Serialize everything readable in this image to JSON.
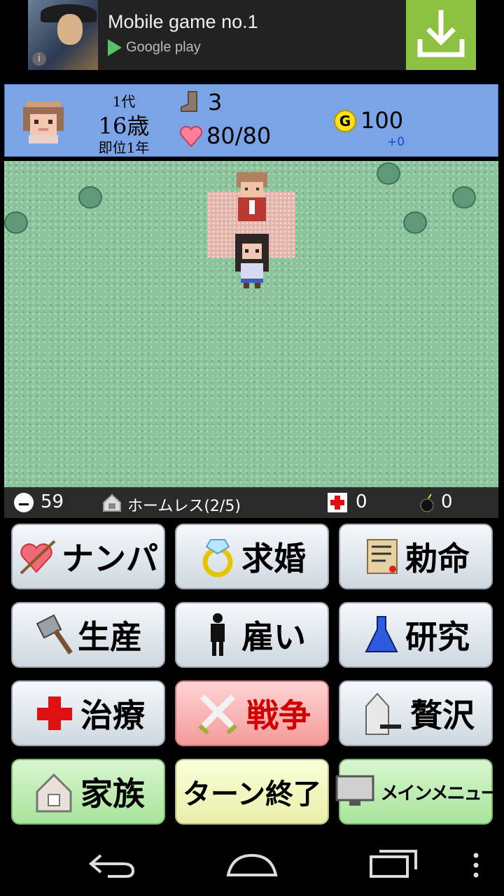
{
  "ad": {
    "title": "Mobile game no.1",
    "store": "Google play",
    "info_glyph": "i"
  },
  "status": {
    "generation": "1代",
    "age": "16歳",
    "reign": "即位1年",
    "floor": "3",
    "hp": "80/80",
    "gold_icon": "G",
    "gold": "100",
    "income": "+0"
  },
  "info": {
    "mood": "59",
    "housing": "ホームレス(2/5)",
    "medicine": "0",
    "bombs": "0"
  },
  "buttons": {
    "nanpa": "ナンパ",
    "kyukon": "求婚",
    "chokumei": "勅命",
    "seisan": "生産",
    "yatoi": "雇い",
    "kenkyu": "研究",
    "chiryo": "治療",
    "senso": "戦争",
    "zeitaku": "贅沢",
    "kazoku": "家族",
    "turn_end": "ターン終了",
    "main_menu": "メインメニュー"
  },
  "colors": {
    "status_bg": "#7ba4e6",
    "map_grass": "#8cc59b",
    "war_button": "#f59a9a",
    "family_button": "#a8e49b",
    "turn_button": "#e8efa9",
    "income": "#1a46d6"
  },
  "icons": {
    "ad_download": "download-icon",
    "boot": "boot-icon",
    "heart": "heart-icon",
    "coin": "gold-coin-icon",
    "mood": "face-icon",
    "house": "house-icon",
    "medicine": "red-cross-icon",
    "bomb": "bomb-icon"
  }
}
